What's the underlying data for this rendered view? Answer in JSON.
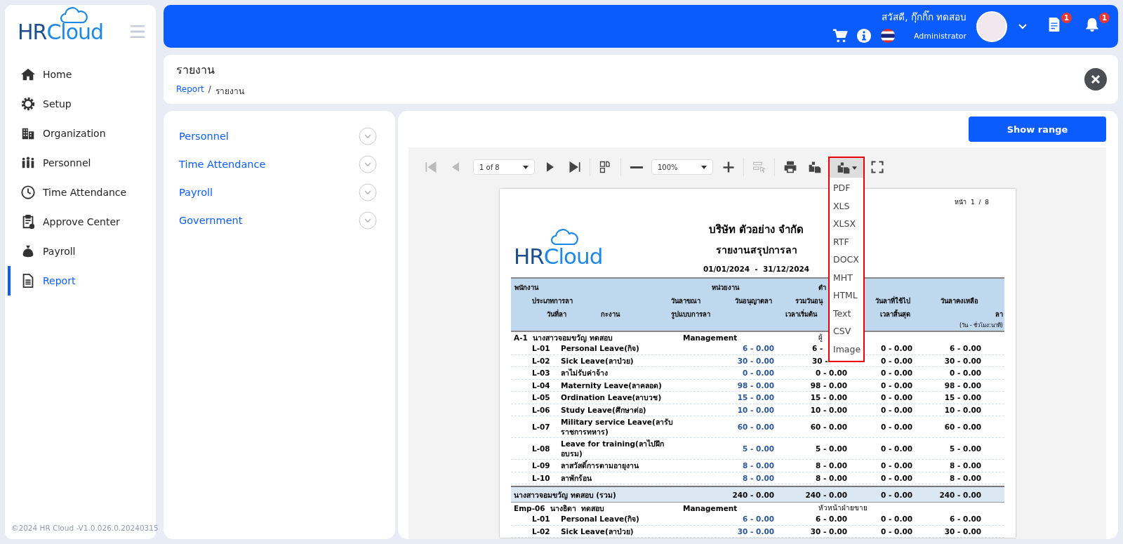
{
  "sidebar": {
    "logo": {
      "part1": "HR",
      "part2": "Cloud"
    },
    "items": [
      {
        "label": "Home",
        "selected": false
      },
      {
        "label": "Setup",
        "selected": false
      },
      {
        "label": "Organization",
        "selected": false
      },
      {
        "label": "Personnel",
        "selected": false
      },
      {
        "label": "Time Attendance",
        "selected": false
      },
      {
        "label": "Approve Center",
        "selected": false
      },
      {
        "label": "Payroll",
        "selected": false
      },
      {
        "label": "Report",
        "selected": true
      }
    ],
    "footer": "©2024 HR Cloud -V1.0.026.0.20240315"
  },
  "header": {
    "greeting": "สวัสดี, กุ๊กกิ๊ก ทดสอบ",
    "role": "Administrator",
    "documents_badge": "1",
    "notifications_badge": "1"
  },
  "page": {
    "title": "รายงาน",
    "breadcrumb": [
      {
        "label": "Report",
        "kind": "link"
      },
      {
        "label": "/",
        "kind": "separator"
      },
      {
        "label": "รายงาน",
        "kind": "current"
      }
    ]
  },
  "categories": [
    {
      "label": "Personnel",
      "expanded": false
    },
    {
      "label": "Time Attendance",
      "expanded": false
    },
    {
      "label": "Payroll",
      "expanded": false
    },
    {
      "label": "Government",
      "expanded": false
    }
  ],
  "viewer": {
    "show_range_button": "Show range",
    "toolbar": [
      {
        "kind": "first",
        "disabled": true
      },
      {
        "kind": "prev",
        "disabled": true
      },
      {
        "kind": "page_select",
        "value": "1 of 8"
      },
      {
        "kind": "next",
        "disabled": false
      },
      {
        "kind": "last",
        "disabled": false
      },
      {
        "kind": "sep"
      },
      {
        "kind": "multipage",
        "disabled": false
      },
      {
        "kind": "sep"
      },
      {
        "kind": "zoom_out",
        "disabled": false
      },
      {
        "kind": "zoom_select",
        "value": "100%"
      },
      {
        "kind": "zoom_in",
        "disabled": false
      },
      {
        "kind": "sep"
      },
      {
        "kind": "editor",
        "disabled": true
      },
      {
        "kind": "sep"
      },
      {
        "kind": "print",
        "disabled": false
      },
      {
        "kind": "save",
        "disabled": false
      },
      {
        "kind": "export",
        "disabled": false,
        "open": true
      },
      {
        "kind": "fullscreen",
        "disabled": false
      }
    ],
    "export_menu": [
      "PDF",
      "XLS",
      "XLSX",
      "RTF",
      "DOCX",
      "MHT",
      "HTML",
      "Text",
      "CSV",
      "Image"
    ],
    "report": {
      "page_label": "หน้า  1  /  8",
      "logo": {
        "part1": "HR",
        "part2": "Cloud"
      },
      "company": "บริษัท ตัวอย่าง จำกัด",
      "title": "รายงานสรุปการลา",
      "period": "01/01/2024  -  31/12/2024",
      "header_lines": [
        [
          "พนักงาน",
          "หน่วยงาน",
          "ตำ"
        ],
        [
          "ประเภทการลา",
          "วันลาขณา",
          "วันอนุญาตลา",
          "รวมวันอนุ",
          "วันลาที่ใช้ไป",
          "วันลาคงเหลือ"
        ],
        [
          "วันที่ลา",
          "กะงาน",
          "รูปแบบการลา",
          "เวลาเริ่มต้น",
          "เวลาสิ้นสุด",
          "ลา"
        ]
      ],
      "unit_note": "(วัน - ชั่วโมง:นาที)",
      "groups": [
        {
          "code": "A-1",
          "name": "นางสาวจอมขวัญ ทดสอบ",
          "department": "Management",
          "position": "ผู้",
          "rows": [
            {
              "code": "L-01",
              "name": "Personal Leave(กิจ)",
              "values": [
                "6 - 0.00",
                "6 -",
                "0 - 0.00",
                "6 - 0.00"
              ]
            },
            {
              "code": "L-02",
              "name": "Sick Leave(ลาป่วย)",
              "values": [
                "30 - 0.00",
                "30 -",
                "0 - 0.00",
                "30 - 0.00"
              ]
            },
            {
              "code": "L-03",
              "name": "ลาไม่รับค่าจ้าง",
              "values": [
                "0 - 0.00",
                "0 - 0.00",
                "0 - 0.00",
                "0 - 0.00"
              ]
            },
            {
              "code": "L-04",
              "name": "Maternity Leave(ลาคลอด)",
              "values": [
                "98 - 0.00",
                "98 - 0.00",
                "0 - 0.00",
                "98 - 0.00"
              ]
            },
            {
              "code": "L-05",
              "name": "Ordination Leave(ลาบวช)",
              "values": [
                "15 - 0.00",
                "15 - 0.00",
                "0 - 0.00",
                "15 - 0.00"
              ]
            },
            {
              "code": "L-06",
              "name": "Study Leave(ศึกษาต่อ)",
              "values": [
                "10 - 0.00",
                "10 - 0.00",
                "0 - 0.00",
                "10 - 0.00"
              ]
            },
            {
              "code": "L-07",
              "name": "Military service Leave(ลารับราชการทหาร)",
              "values": [
                "60 - 0.00",
                "60 - 0.00",
                "0 - 0.00",
                "60 - 0.00"
              ]
            },
            {
              "code": "L-08",
              "name": "Leave for training(ลาไปฝึกอบรม)",
              "values": [
                "5 - 0.00",
                "5 - 0.00",
                "0 - 0.00",
                "5 - 0.00"
              ]
            },
            {
              "code": "L-09",
              "name": "ลาสวัสดิ์การตามอายุงาน",
              "values": [
                "8 - 0.00",
                "8 - 0.00",
                "0 - 0.00",
                "8 - 0.00"
              ]
            },
            {
              "code": "L-10",
              "name": "ลาพักร้อน",
              "values": [
                "8 - 0.00",
                "8 - 0.00",
                "0 - 0.00",
                "8 - 0.00"
              ]
            }
          ],
          "total": {
            "label": "นางสาวจอมขวัญ ทดสอบ (รวม)",
            "values": [
              "240 - 0.00",
              "240 - 0.00",
              "0 - 0.00",
              "240 - 0.00"
            ]
          }
        },
        {
          "code": "Emp-06",
          "name": "นางธิดา  ทดสอบ",
          "department": "Management",
          "position": "หัวหน้าฝ่ายขาย",
          "rows": [
            {
              "code": "L-01",
              "name": "Personal Leave(กิจ)",
              "values": [
                "6 - 0.00",
                "6 - 0.00",
                "0 - 0.00",
                "6 - 0.00"
              ]
            },
            {
              "code": "L-02",
              "name": "Sick Leave(ลาป่วย)",
              "values": [
                "30 - 0.00",
                "30 - 0.00",
                "0 - 0.00",
                "30 - 0.00"
              ]
            }
          ]
        }
      ]
    }
  }
}
